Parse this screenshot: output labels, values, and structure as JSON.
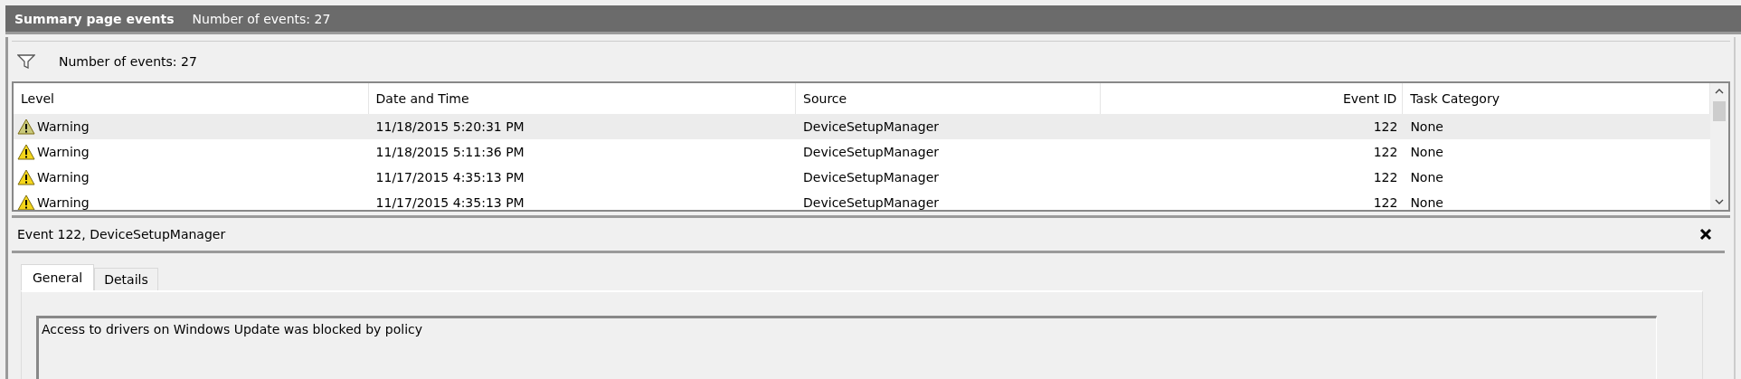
{
  "header": {
    "title": "Summary page events",
    "subtitle": "Number of events: 27"
  },
  "filter_bar": {
    "label": "Number of events: 27"
  },
  "table": {
    "columns": [
      "Level",
      "Date and Time",
      "Source",
      "Event ID",
      "Task Category"
    ],
    "rows": [
      {
        "level": "Warning",
        "date": "11/18/2015 5:20:31 PM",
        "source": "DeviceSetupManager",
        "event_id": "122",
        "task_category": "None",
        "selected": true
      },
      {
        "level": "Warning",
        "date": "11/18/2015 5:11:36 PM",
        "source": "DeviceSetupManager",
        "event_id": "122",
        "task_category": "None",
        "selected": false
      },
      {
        "level": "Warning",
        "date": "11/17/2015 4:35:13 PM",
        "source": "DeviceSetupManager",
        "event_id": "122",
        "task_category": "None",
        "selected": false
      },
      {
        "level": "Warning",
        "date": "11/17/2015 4:35:13 PM",
        "source": "DeviceSetupManager",
        "event_id": "122",
        "task_category": "None",
        "selected": false
      }
    ]
  },
  "details": {
    "title": "Event 122, DeviceSetupManager",
    "tabs": [
      {
        "label": "General",
        "selected": true
      },
      {
        "label": "Details",
        "selected": false
      }
    ],
    "message": "Access to drivers on Windows Update was blocked by policy"
  }
}
